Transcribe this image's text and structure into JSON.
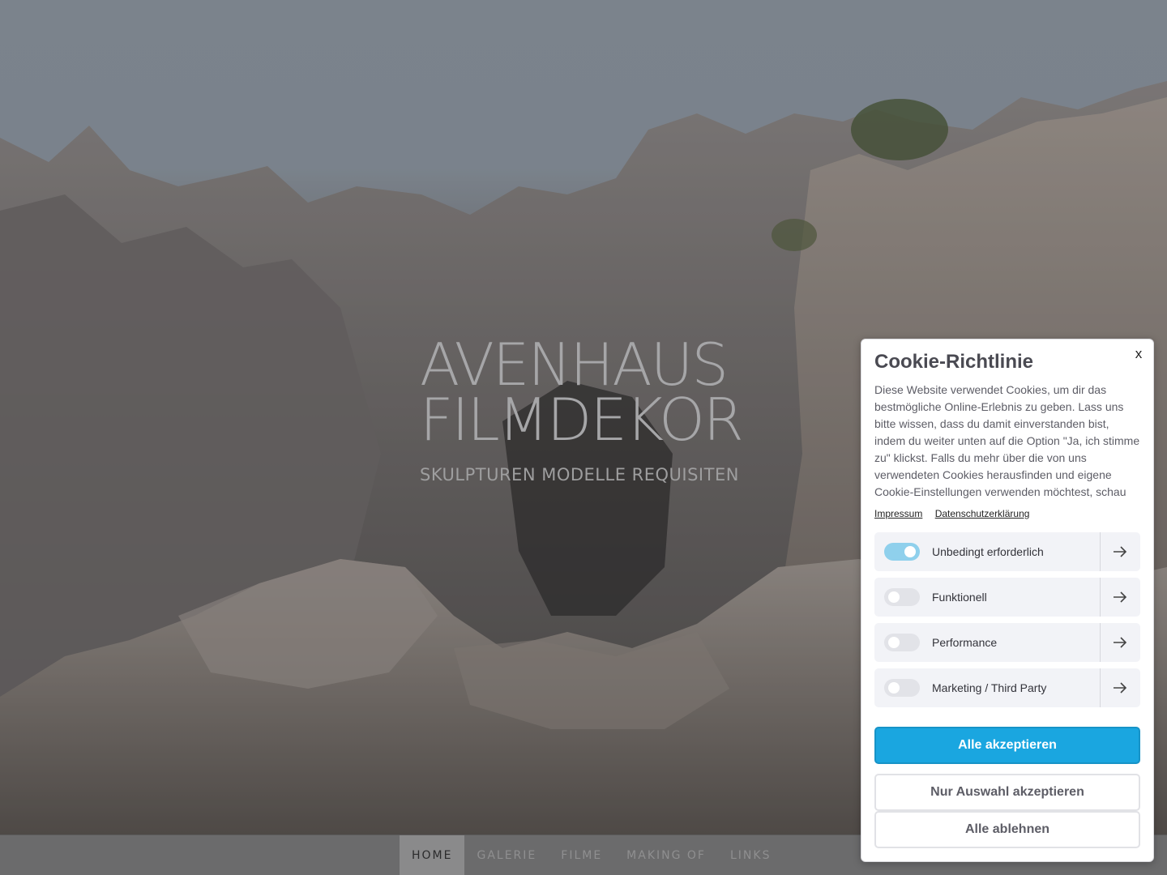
{
  "hero": {
    "title_line1": "AVENHAUS",
    "title_line2": "FILMDEKOR",
    "tagline": "SKULPTUREN MODELLE REQUISITEN"
  },
  "nav": {
    "items": [
      {
        "label": "HOME",
        "active": true
      },
      {
        "label": "GALERIE",
        "active": false
      },
      {
        "label": "FILME",
        "active": false
      },
      {
        "label": "MAKING OF",
        "active": false
      },
      {
        "label": "LINKS",
        "active": false
      }
    ]
  },
  "cookie": {
    "close_label": "x",
    "title": "Cookie-Richtlinie",
    "description": "Diese Website verwendet Cookies, um dir das bestmögliche Online-Erlebnis zu geben. Lass uns bitte wissen, dass du damit einverstanden bist, indem du weiter unten auf die Option \"Ja, ich stimme zu\" klickst. Falls du mehr über die von uns verwendeten Cookies herausfinden und eigene Cookie-Einstellungen verwenden möchtest, schau",
    "links": {
      "impressum": "Impressum",
      "privacy": "Datenschutzerklärung"
    },
    "categories": [
      {
        "label": "Unbedingt erforderlich",
        "enabled": true
      },
      {
        "label": "Funktionell",
        "enabled": false
      },
      {
        "label": "Performance",
        "enabled": false
      },
      {
        "label": "Marketing / Third Party",
        "enabled": false
      }
    ],
    "buttons": {
      "accept_all": "Alle akzeptieren",
      "accept_selection": "Nur Auswahl akzeptieren",
      "reject_all": "Alle ablehnen"
    },
    "colors": {
      "primary": "#1aa6e0",
      "toggle_on": "#8fd0ec"
    }
  }
}
